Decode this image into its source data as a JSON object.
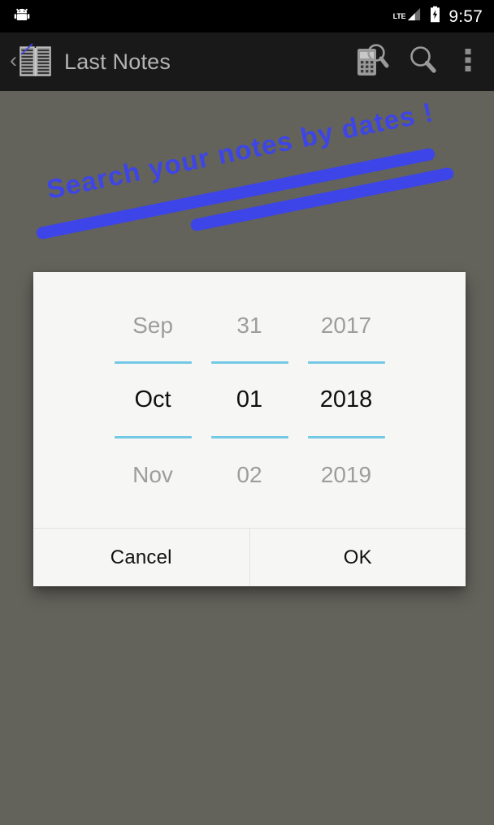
{
  "status_bar": {
    "notification_icon": "android-robot-icon",
    "network_label": "LTE",
    "signal_icon": "signal-bars-icon",
    "battery_icon": "battery-charging-icon",
    "clock": "9:57"
  },
  "toolbar": {
    "up_icon": "back-chevron-icon",
    "app_icon": "notebook-icon",
    "title": "Last Notes",
    "actions": [
      {
        "name": "search-by-date-button",
        "icon": "calendar-search-icon"
      },
      {
        "name": "search-button",
        "icon": "magnifier-icon"
      },
      {
        "name": "overflow-menu-button",
        "icon": "three-dots-vertical-icon"
      }
    ]
  },
  "hero": {
    "message": "Search your notes by dates !",
    "accent_color": "#3d45e8"
  },
  "colors": {
    "status_bar_bg": "#000000",
    "toolbar_bg": "#191919",
    "background": "#63625b",
    "dialog_bg": "#f6f6f5",
    "picker_rule": "#73c8e6",
    "picker_dim_text": "#9d9d9d",
    "picker_selected_text": "#0f0f0f"
  },
  "dialog": {
    "name": "date-picker-dialog",
    "picker": {
      "month": {
        "previous": "Sep",
        "selected": "Oct",
        "next": "Nov"
      },
      "day": {
        "previous": "31",
        "selected": "01",
        "next": "02"
      },
      "year": {
        "previous": "2017",
        "selected": "2018",
        "next": "2019"
      }
    },
    "buttons": {
      "cancel": "Cancel",
      "ok": "OK"
    }
  }
}
